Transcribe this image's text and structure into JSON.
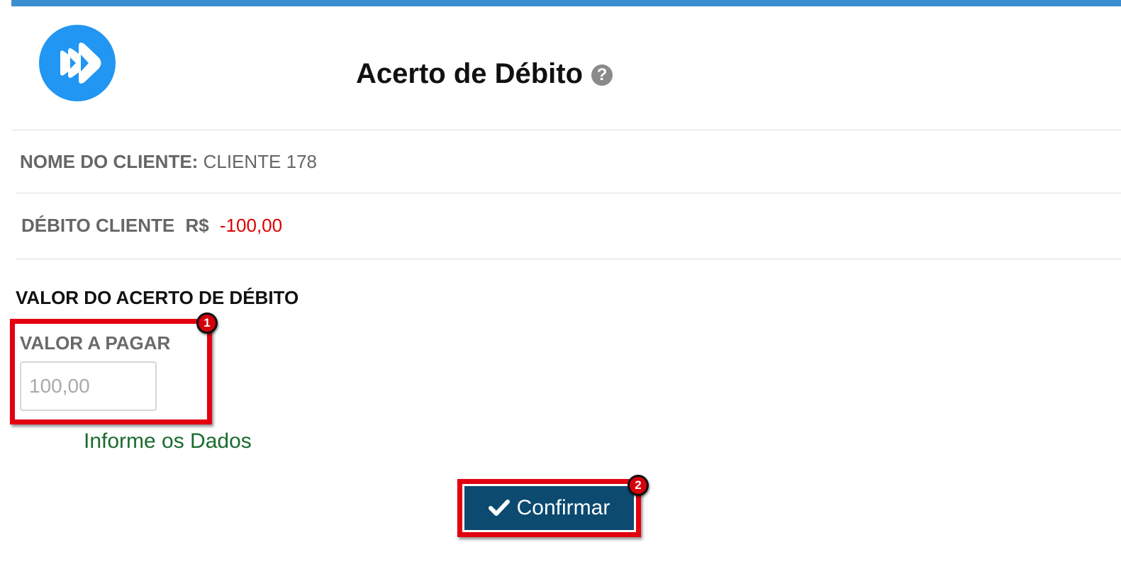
{
  "header": {
    "title": "Acerto de Débito",
    "help_icon": "?"
  },
  "client": {
    "name_label": "NOME DO CLIENTE:",
    "name_value": "CLIENTE 178"
  },
  "debit": {
    "label": "DÉBITO CLIENTE",
    "currency": "R$",
    "value": "-100,00"
  },
  "form": {
    "section_title": "VALOR DO ACERTO DE DÉBITO",
    "field_label": "VALOR A PAGAR",
    "field_placeholder": "100,00",
    "hint": "Informe os Dados",
    "confirm_label": "Confirmar"
  },
  "annotations": {
    "badge_1": "1",
    "badge_2": "2"
  },
  "colors": {
    "top_bar": "#3b8fd0",
    "logo": "#2196f3",
    "button": "#0c4a70",
    "negative_value": "#e00000",
    "hint": "#1a6b2f",
    "callout": "#e3000f"
  }
}
